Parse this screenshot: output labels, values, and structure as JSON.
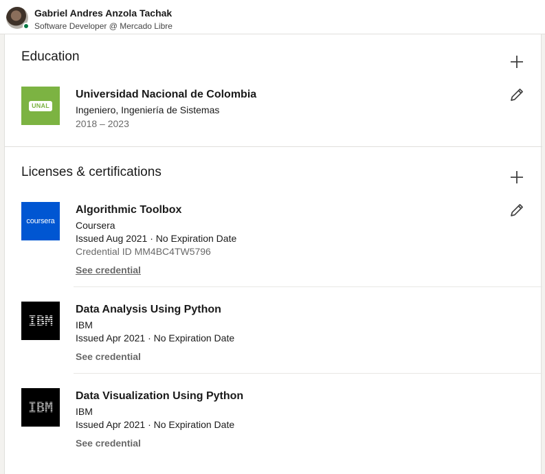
{
  "profile": {
    "name": "Gabriel Andres Anzola Tachak",
    "headline": "Software Developer @ Mercado Libre"
  },
  "education": {
    "title": "Education",
    "items": [
      {
        "logo_text": "UNAL",
        "school": "Universidad Nacional de Colombia",
        "degree": "Ingeniero, Ingeniería de Sistemas",
        "dates": "2018 – 2023"
      }
    ]
  },
  "licenses": {
    "title": "Licenses & certifications",
    "items": [
      {
        "logo_text": "coursera",
        "name": "Algorithmic Toolbox",
        "issuer": "Coursera",
        "issued": "Issued Aug 2021 · No Expiration Date",
        "credential_id": "Credential ID MM4BC4TW5796",
        "link_label": "See credential"
      },
      {
        "logo_text": "IBM",
        "name": "Data Analysis Using Python",
        "issuer": "IBM",
        "issued": "Issued Apr 2021 · No Expiration Date",
        "link_label": "See credential"
      },
      {
        "logo_text": "IBM",
        "name": "Data Visualization Using Python",
        "issuer": "IBM",
        "issued": "Issued Apr 2021 · No Expiration Date",
        "link_label": "See credential"
      }
    ]
  },
  "icons": {
    "add": "plus-icon",
    "edit": "pencil-icon"
  },
  "colors": {
    "unal_green": "#7cb342",
    "coursera_blue": "#0056d2",
    "ibm_black": "#000000",
    "online_green": "#057642"
  }
}
